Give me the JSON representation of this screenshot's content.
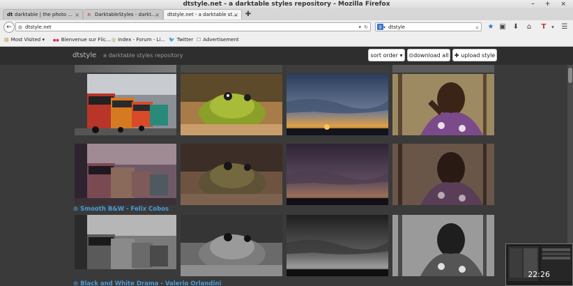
{
  "window": {
    "title": "dtstyle.net - a darktable styles repository - Mozilla Firefox",
    "controls": "– + ×"
  },
  "tabs": [
    {
      "icon": "dt",
      "label": "darktable | the photo ..."
    },
    {
      "icon": "∩",
      "label": "DarktableStyles - darkt..."
    },
    {
      "icon": "",
      "label": "dtstyle.net - a darktable st..."
    }
  ],
  "new_tab": "✚",
  "nav": {
    "url": "dtstyle.net",
    "search": "dtstyle"
  },
  "bookmarks": [
    {
      "icon": "▤",
      "label": "Most Visited ▾"
    },
    {
      "icon": "●●",
      "label": "Bienvenue sur Flic..."
    },
    {
      "icon": "◎",
      "label": "Index - Forum - Li..."
    },
    {
      "icon": "🐦",
      "label": "Twitter"
    },
    {
      "icon": "☐",
      "label": "Advertisement"
    }
  ],
  "site": {
    "brand": "dtstyle",
    "tagline": "a darktable styles repository",
    "sort_label": "sort order ▾",
    "download_label": "download all",
    "upload_label": "upload style"
  },
  "sections": [
    {
      "title": "Smooth B&W - Felix Cobos"
    },
    {
      "title": "Black and White Drama - Valerio Orlandini"
    }
  ],
  "clock": "22:26",
  "colors": {
    "accent": "#4a9ad8",
    "page_bg": "#3a3a3a",
    "header_bg": "#2e2e2e"
  }
}
